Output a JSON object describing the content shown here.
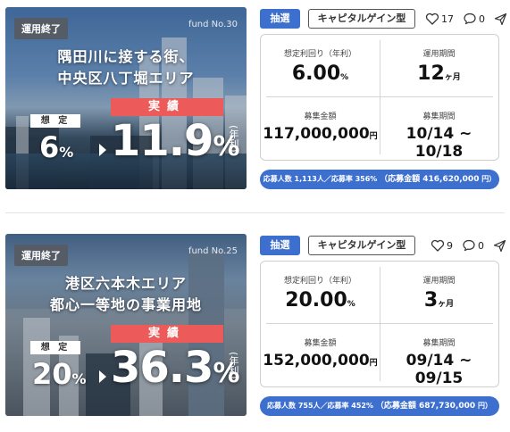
{
  "funds": [
    {
      "status_badge": "運用終了",
      "fund_no": "fund No.30",
      "title_line1": "隅田川に接する街、",
      "title_line2": "中央区八丁堀エリア",
      "estimated_label": "想 定",
      "estimated_value": "6",
      "pct": "%",
      "actual_label": "実績",
      "actual_value": "11.9",
      "annual": "年利",
      "tag_lottery": "抽選",
      "tag_type": "キャピタルゲイン型",
      "like_count": "17",
      "comment_count": "0",
      "yield_label": "想定利回り（年利）",
      "yield_value": "6.00",
      "yield_unit": "%",
      "period_label": "運用期間",
      "period_value": "12",
      "period_unit": "ヶ月",
      "amount_label": "募集金額",
      "amount_value": "117,000,000",
      "amount_unit": "円",
      "recruit_label": "募集期間",
      "recruit_value": "10/14 ~ 10/18",
      "summary_count": "応募人数 1,113人／応募率 356%",
      "summary_amount": "（応募金額 416,620,000",
      "summary_unit": "円）"
    },
    {
      "status_badge": "運用終了",
      "fund_no": "fund No.25",
      "title_line1": "港区六本木エリア",
      "title_line2": "都心一等地の事業用地",
      "estimated_label": "想 定",
      "estimated_value": "20",
      "pct": "%",
      "actual_label": "実績",
      "actual_value": "36.3",
      "annual": "年利",
      "tag_lottery": "抽選",
      "tag_type": "キャピタルゲイン型",
      "like_count": "9",
      "comment_count": "0",
      "yield_label": "想定利回り（年利）",
      "yield_value": "20.00",
      "yield_unit": "%",
      "period_label": "運用期間",
      "period_value": "3",
      "period_unit": "ヶ月",
      "amount_label": "募集金額",
      "amount_value": "152,000,000",
      "amount_unit": "円",
      "recruit_label": "募集期間",
      "recruit_value": "09/14 ~ 09/15",
      "summary_count": "応募人数 755人／応募率 452%",
      "summary_amount": "（応募金額 687,730,000",
      "summary_unit": "円）"
    }
  ],
  "colors": {
    "accent_blue": "#3d6fcf",
    "actual_red": "#ec5a5a",
    "badge_gray": "#555c66"
  },
  "icons": [
    "heart-icon",
    "comment-icon",
    "share-send-icon"
  ]
}
